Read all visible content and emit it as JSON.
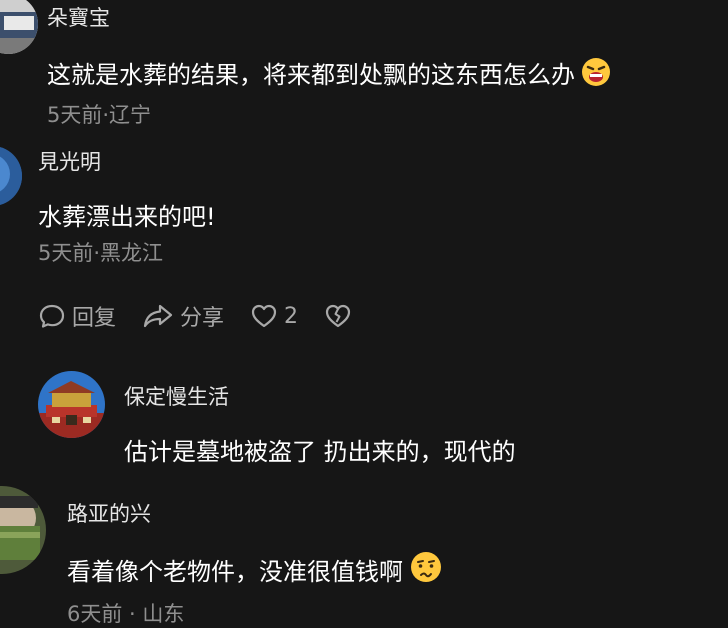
{
  "comments": [
    {
      "username": "朵寶宝",
      "text": "这就是水葬的结果，将来都到处飘的这东西怎么办",
      "emoji": "angry-face-emoji",
      "meta": "5天前·辽宁"
    },
    {
      "username": "見光明",
      "text": "水葬漂出来的吧!",
      "meta": "5天前·黑龙江"
    },
    {
      "username": "保定慢生活",
      "text": "估计是墓地被盗了 扔出来的，现代的"
    },
    {
      "username": "路亚的兴",
      "text": "看着像个老物件，没准很值钱啊",
      "emoji": "confused-face-emoji",
      "meta": "6天前 · 山东"
    }
  ],
  "actions": {
    "reply": "回复",
    "share": "分享",
    "like_count": "2"
  },
  "colors": {
    "background": "#161616",
    "text": "#ffffff",
    "meta": "#8f8f8f",
    "action": "#a8a8a8",
    "emoji_yellow": "#ffc83d"
  }
}
